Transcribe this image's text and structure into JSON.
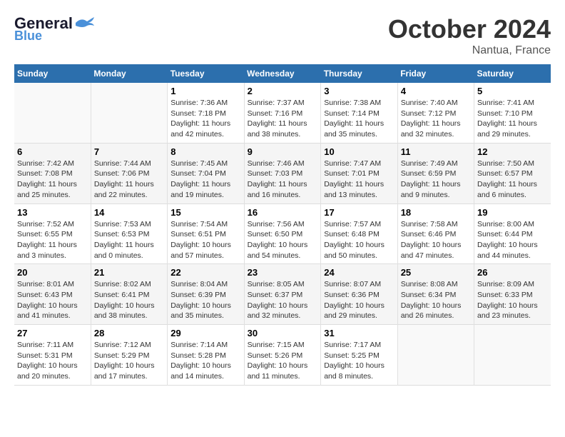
{
  "logo": {
    "text_general": "General",
    "text_blue": "Blue"
  },
  "title": "October 2024",
  "subtitle": "Nantua, France",
  "days_of_week": [
    "Sunday",
    "Monday",
    "Tuesday",
    "Wednesday",
    "Thursday",
    "Friday",
    "Saturday"
  ],
  "weeks": [
    [
      {
        "day": "",
        "info": ""
      },
      {
        "day": "",
        "info": ""
      },
      {
        "day": "1",
        "info": "Sunrise: 7:36 AM\nSunset: 7:18 PM\nDaylight: 11 hours and 42 minutes."
      },
      {
        "day": "2",
        "info": "Sunrise: 7:37 AM\nSunset: 7:16 PM\nDaylight: 11 hours and 38 minutes."
      },
      {
        "day": "3",
        "info": "Sunrise: 7:38 AM\nSunset: 7:14 PM\nDaylight: 11 hours and 35 minutes."
      },
      {
        "day": "4",
        "info": "Sunrise: 7:40 AM\nSunset: 7:12 PM\nDaylight: 11 hours and 32 minutes."
      },
      {
        "day": "5",
        "info": "Sunrise: 7:41 AM\nSunset: 7:10 PM\nDaylight: 11 hours and 29 minutes."
      }
    ],
    [
      {
        "day": "6",
        "info": "Sunrise: 7:42 AM\nSunset: 7:08 PM\nDaylight: 11 hours and 25 minutes."
      },
      {
        "day": "7",
        "info": "Sunrise: 7:44 AM\nSunset: 7:06 PM\nDaylight: 11 hours and 22 minutes."
      },
      {
        "day": "8",
        "info": "Sunrise: 7:45 AM\nSunset: 7:04 PM\nDaylight: 11 hours and 19 minutes."
      },
      {
        "day": "9",
        "info": "Sunrise: 7:46 AM\nSunset: 7:03 PM\nDaylight: 11 hours and 16 minutes."
      },
      {
        "day": "10",
        "info": "Sunrise: 7:47 AM\nSunset: 7:01 PM\nDaylight: 11 hours and 13 minutes."
      },
      {
        "day": "11",
        "info": "Sunrise: 7:49 AM\nSunset: 6:59 PM\nDaylight: 11 hours and 9 minutes."
      },
      {
        "day": "12",
        "info": "Sunrise: 7:50 AM\nSunset: 6:57 PM\nDaylight: 11 hours and 6 minutes."
      }
    ],
    [
      {
        "day": "13",
        "info": "Sunrise: 7:52 AM\nSunset: 6:55 PM\nDaylight: 11 hours and 3 minutes."
      },
      {
        "day": "14",
        "info": "Sunrise: 7:53 AM\nSunset: 6:53 PM\nDaylight: 11 hours and 0 minutes."
      },
      {
        "day": "15",
        "info": "Sunrise: 7:54 AM\nSunset: 6:51 PM\nDaylight: 10 hours and 57 minutes."
      },
      {
        "day": "16",
        "info": "Sunrise: 7:56 AM\nSunset: 6:50 PM\nDaylight: 10 hours and 54 minutes."
      },
      {
        "day": "17",
        "info": "Sunrise: 7:57 AM\nSunset: 6:48 PM\nDaylight: 10 hours and 50 minutes."
      },
      {
        "day": "18",
        "info": "Sunrise: 7:58 AM\nSunset: 6:46 PM\nDaylight: 10 hours and 47 minutes."
      },
      {
        "day": "19",
        "info": "Sunrise: 8:00 AM\nSunset: 6:44 PM\nDaylight: 10 hours and 44 minutes."
      }
    ],
    [
      {
        "day": "20",
        "info": "Sunrise: 8:01 AM\nSunset: 6:43 PM\nDaylight: 10 hours and 41 minutes."
      },
      {
        "day": "21",
        "info": "Sunrise: 8:02 AM\nSunset: 6:41 PM\nDaylight: 10 hours and 38 minutes."
      },
      {
        "day": "22",
        "info": "Sunrise: 8:04 AM\nSunset: 6:39 PM\nDaylight: 10 hours and 35 minutes."
      },
      {
        "day": "23",
        "info": "Sunrise: 8:05 AM\nSunset: 6:37 PM\nDaylight: 10 hours and 32 minutes."
      },
      {
        "day": "24",
        "info": "Sunrise: 8:07 AM\nSunset: 6:36 PM\nDaylight: 10 hours and 29 minutes."
      },
      {
        "day": "25",
        "info": "Sunrise: 8:08 AM\nSunset: 6:34 PM\nDaylight: 10 hours and 26 minutes."
      },
      {
        "day": "26",
        "info": "Sunrise: 8:09 AM\nSunset: 6:33 PM\nDaylight: 10 hours and 23 minutes."
      }
    ],
    [
      {
        "day": "27",
        "info": "Sunrise: 7:11 AM\nSunset: 5:31 PM\nDaylight: 10 hours and 20 minutes."
      },
      {
        "day": "28",
        "info": "Sunrise: 7:12 AM\nSunset: 5:29 PM\nDaylight: 10 hours and 17 minutes."
      },
      {
        "day": "29",
        "info": "Sunrise: 7:14 AM\nSunset: 5:28 PM\nDaylight: 10 hours and 14 minutes."
      },
      {
        "day": "30",
        "info": "Sunrise: 7:15 AM\nSunset: 5:26 PM\nDaylight: 10 hours and 11 minutes."
      },
      {
        "day": "31",
        "info": "Sunrise: 7:17 AM\nSunset: 5:25 PM\nDaylight: 10 hours and 8 minutes."
      },
      {
        "day": "",
        "info": ""
      },
      {
        "day": "",
        "info": ""
      }
    ]
  ]
}
